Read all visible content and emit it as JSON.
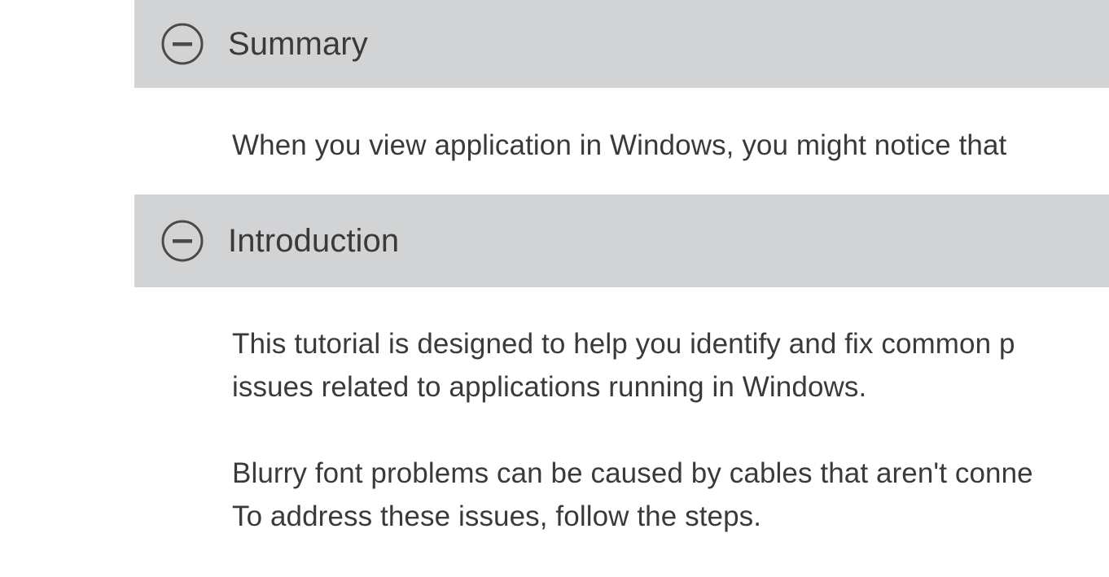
{
  "document": {
    "background_color": "#ffffff",
    "text_color": "#3a3a3a",
    "header_band_color": "#d2d3d5"
  },
  "sections": [
    {
      "id": "summary",
      "title": "Summary",
      "collapse_icon": "minus-circle-icon",
      "expanded": true,
      "paragraphs": [
        {
          "lines": [
            "When you view application in Windows, you might notice that"
          ]
        }
      ]
    },
    {
      "id": "introduction",
      "title": "Introduction",
      "collapse_icon": "minus-circle-icon",
      "expanded": true,
      "paragraphs": [
        {
          "lines": [
            "This tutorial is designed to help you identify and fix common p",
            "issues related to applications running in Windows."
          ]
        },
        {
          "lines": [
            "Blurry font problems can be caused by cables that aren't conne",
            "To address these issues, follow the steps."
          ]
        }
      ]
    }
  ]
}
